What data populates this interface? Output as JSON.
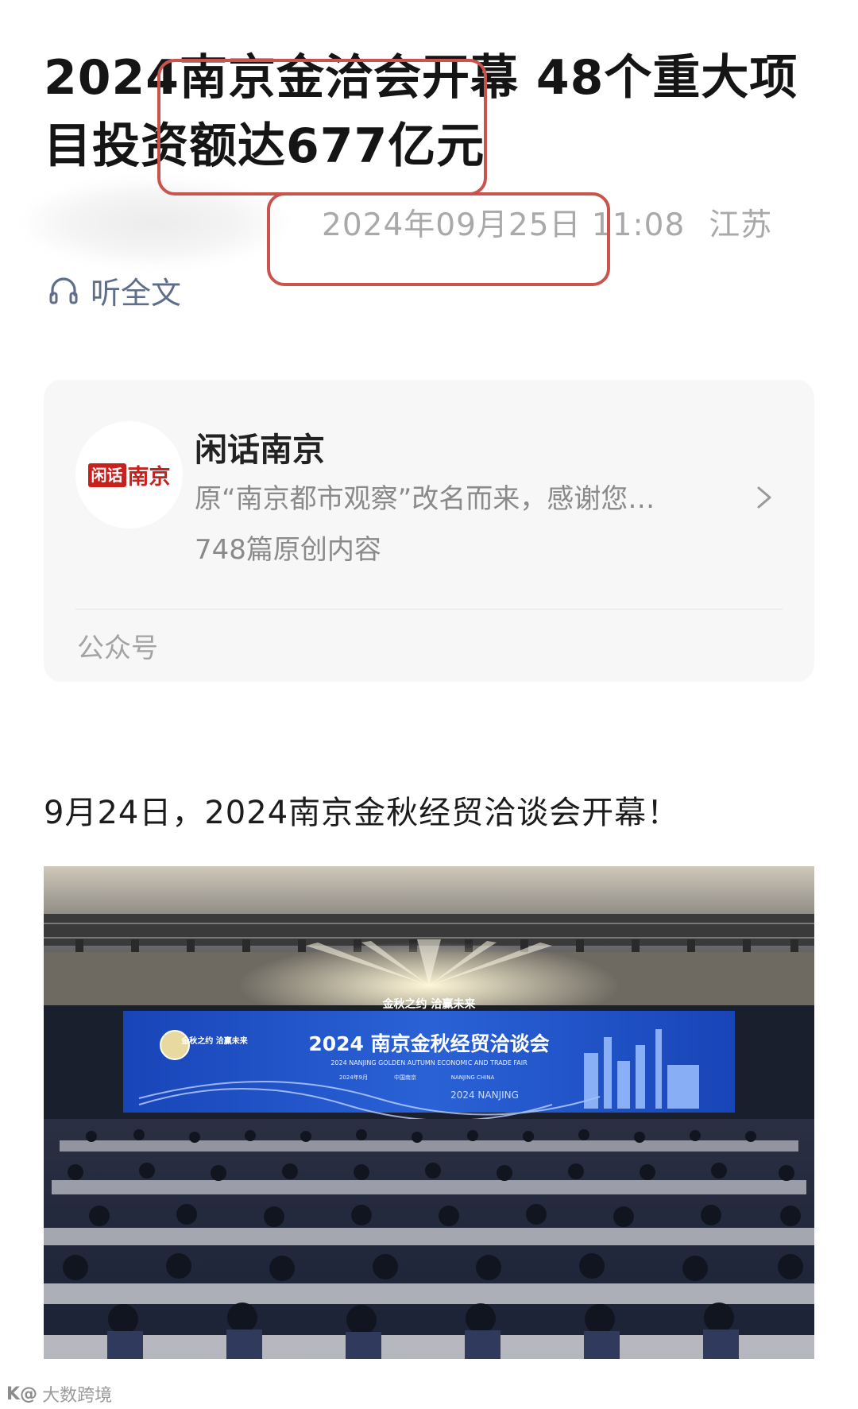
{
  "article": {
    "title": "2024南京金洽会开幕 48个重大项目投资额达677亿元",
    "datetime": "2024年09月25日 11:08",
    "region": "江苏",
    "listen_label": "听全文",
    "lead": "9月24日，2024南京金秋经贸洽谈会开幕！"
  },
  "account_card": {
    "logo_box_text": "闲话",
    "logo_text": "南京",
    "name": "闲话南京",
    "description": "原“南京都市观察”改名而来，感谢您…",
    "count": "748篇原创内容",
    "type_label": "公众号"
  },
  "photo": {
    "slogan": "金秋之约 洽赢未来",
    "stage_title": "2024 南京金秋经贸洽谈会",
    "stage_subtitle": "2024 NANJING GOLDEN AUTUMN ECONOMIC AND TRADE FAIR",
    "stage_date": "2024年9月",
    "stage_place_cn": "中国南京",
    "stage_place_en": "NANJING CHINA",
    "stage_logo_text": "金秋之约 洽赢未来",
    "stage_year_mark": "2024 NANJING"
  },
  "watermark": {
    "logo": "K@",
    "text": "大数跨境"
  },
  "colors": {
    "highlight": "#c9534d",
    "brand_red": "#c8201d",
    "meta_gray": "#a9a9a9",
    "listen_blue": "#5e6e8a",
    "stage_blue": "#1f57c9"
  },
  "icons": [
    "headphones-icon",
    "chevron-right-icon"
  ]
}
